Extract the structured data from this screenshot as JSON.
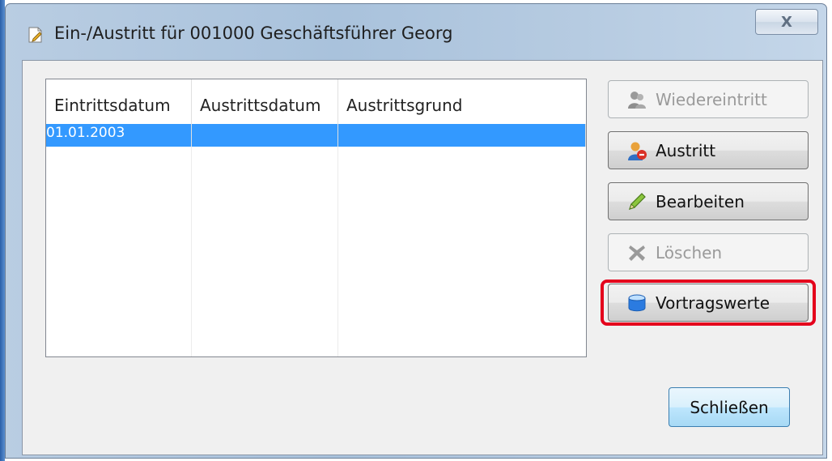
{
  "window": {
    "title": "Ein-/Austritt für 001000 Geschäftsführer Georg",
    "close_glyph": "X",
    "title_icon": "edit-document-icon"
  },
  "table": {
    "columns": [
      "Eintrittsdatum",
      "Austrittsdatum",
      "Austrittsgrund"
    ],
    "rows": [
      {
        "eintrittsdatum": "01.01.2003",
        "austrittsdatum": "",
        "austrittsgrund": "",
        "selected": true
      }
    ],
    "selection_color": "#3399ff"
  },
  "buttons": {
    "wiedereintritt": {
      "label": "Wiedereintritt",
      "enabled": false,
      "icon": "user-gray-icon"
    },
    "austritt": {
      "label": "Austritt",
      "enabled": true,
      "icon": "user-remove-icon"
    },
    "bearbeiten": {
      "label": "Bearbeiten",
      "enabled": true,
      "icon": "pencil-icon"
    },
    "loeschen": {
      "label": "Löschen",
      "enabled": false,
      "icon": "delete-x-icon"
    },
    "vortragswerte": {
      "label": "Vortragswerte",
      "enabled": true,
      "icon": "database-icon",
      "highlighted": true
    },
    "schliessen": {
      "label": "Schließen",
      "enabled": true
    }
  },
  "colors": {
    "highlight": "#e4001c"
  }
}
